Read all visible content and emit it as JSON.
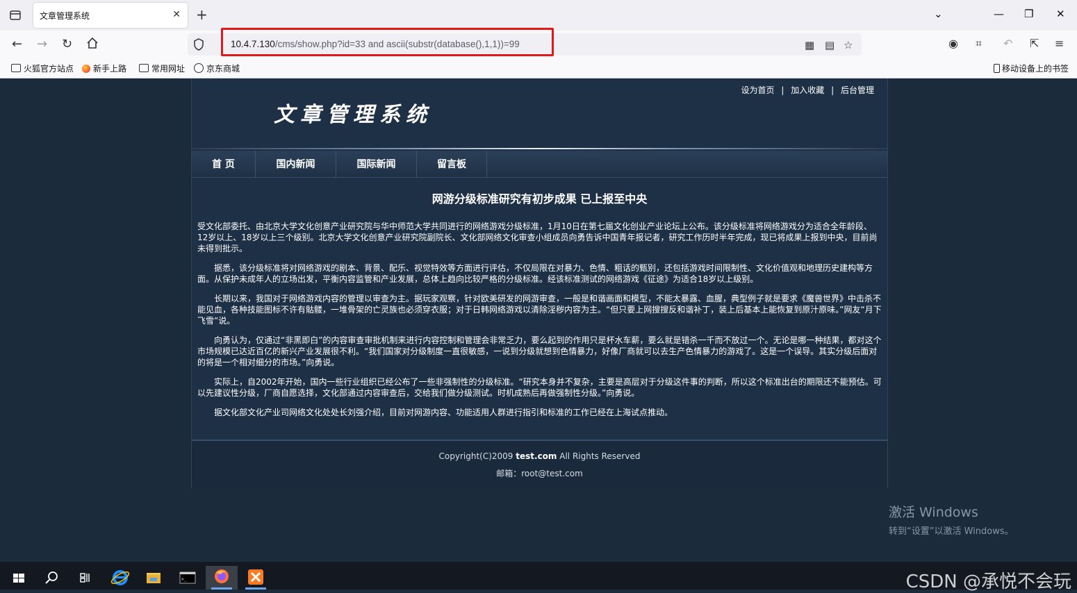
{
  "browser": {
    "tab_title": "文章管理系统",
    "url_host": "10.4.7.130",
    "url_rest": "/cms/show.php?id=33 and ascii(substr(database(),1,1))=99",
    "bookmarks": [
      "火狐官方站点",
      "新手上路",
      "常用网址",
      "京东商城"
    ],
    "mobile_bookmarks": "移动设备上的书签"
  },
  "site": {
    "toplinks": [
      "设为首页",
      "加入收藏",
      "后台管理"
    ],
    "separator": "|",
    "logo": "文章管理系统",
    "nav": [
      "首 页",
      "国内新闻",
      "国际新闻",
      "留言板"
    ],
    "article_title": "网游分级标准研究有初步成果 已上报至中央",
    "paragraphs": [
      "受文化部委托、由北京大学文化创意产业研究院与华中师范大学共同进行的网络游戏分级标准，1月10日在第七届文化创业产业论坛上公布。该分级标准将网络游戏分为适合全年龄段、12岁以上、18岁以上三个级别。北京大学文化创意产业研究院副院长、文化部网络文化审查小组成员向勇告诉中国青年报记者，研究工作历时半年完成，现已将成果上报到中央，目前尚未得到批示。",
      "据悉，该分级标准将对网络游戏的剧本、背景、配乐、视觉特效等方面进行评估，不仅局限在对暴力、色情、粗话的甄别，还包括游戏时间限制性、文化价值观和地理历史建构等方面。从保护未成年人的立场出发，平衡内容监管和产业发展，总体上趋向比较严格的分级标准。经该标准测试的网络游戏《征途》为适合18岁以上级别。",
      "长期以来，我国对于网络游戏内容的管理以审查为主。据玩家观察，针对欧美研发的网游审查，一般是和谐画面和模型，不能太暴露、血腥，典型例子就是要求《魔兽世界》中击杀不能见血，各种技能图标不许有骷髅，一堆骨架的亡灵族也必须穿衣服；对于日韩网络游戏以清除淫秽内容为主。“但只要上网搜搜反和谐补丁，装上后基本上能恢复到原汁原味。”网友“月下飞雪”说。",
      "向勇认为，仅通过“非黑即白”的内容审查审批机制来进行内容控制和管理会非常乏力，要么起到的作用只是杯水车薪，要么就是错杀一千而不放过一个。无论是哪一种结果，都对这个市场规模已达近百亿的新兴产业发展很不利。“我们国家对分级制度一直很敏感，一说到分级就想到色情暴力，好像厂商就可以去生产色情暴力的游戏了。这是一个误导。其实分级后面对的将是一个相对细分的市场。”向勇说。",
      "实际上，自2002年开始，国内一些行业组织已经公布了一些非强制性的分级标准。“研究本身并不复杂，主要是高层对于分级这件事的判断，所以这个标准出台的期限还不能预估。可以先建议性分级，厂商自愿选择，文化部通过内容审查后，交给我们做分级测试。时机成熟后再做强制性分级。”向勇说。",
      "据文化部文化产业司网络文化处处长刘强介绍，目前对网游内容、功能适用人群进行指引和标准的工作已经在上海试点推动。"
    ],
    "footer_copyright_prefix": "Copyright(C)2009 ",
    "footer_domain": "test.com",
    "footer_copyright_suffix": " All Rights Reserved",
    "footer_email": "邮箱：root@test.com"
  },
  "activation": {
    "title": "激活 Windows",
    "subtitle": "转到“设置”以激活 Windows。"
  },
  "watermark": "CSDN @承悦不会玩",
  "colors": {
    "page_bg": "#1b2b3c",
    "site_bg": "#1e3046",
    "highlight": "#e0191a"
  }
}
